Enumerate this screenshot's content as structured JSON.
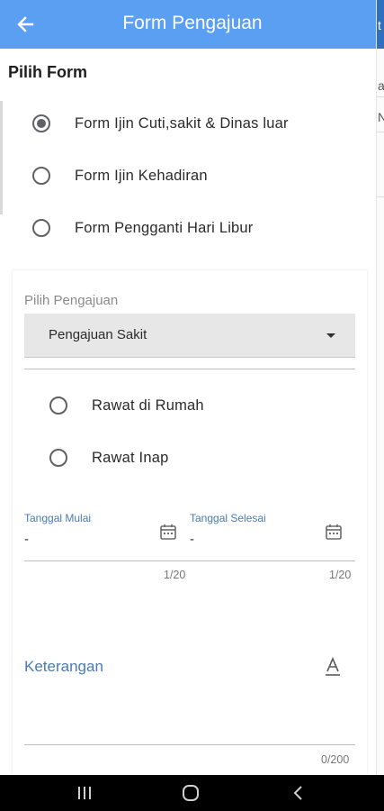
{
  "app": {
    "title": "Form Pengajuan"
  },
  "section": {
    "heading": "Pilih Form"
  },
  "form_options": [
    {
      "label": "Form Ijin Cuti,sakit & Dinas luar",
      "selected": true
    },
    {
      "label": "Form Ijin Kehadiran",
      "selected": false
    },
    {
      "label": "Form Pengganti Hari Libur",
      "selected": false
    }
  ],
  "pengajuan": {
    "label": "Pilih Pengajuan",
    "value": "Pengajuan Sakit"
  },
  "rawat_options": [
    {
      "label": "Rawat di Rumah",
      "selected": false
    },
    {
      "label": "Rawat Inap",
      "selected": false
    }
  ],
  "tanggal_mulai": {
    "label": "Tanggal Mulai",
    "value": "-",
    "counter": "1/20"
  },
  "tanggal_selesai": {
    "label": "Tanggal Selesai",
    "value": "-",
    "counter": "1/20"
  },
  "keterangan": {
    "label": "Keterangan",
    "counter": "0/200"
  },
  "icons": {
    "back": "arrow-left-icon",
    "calendar": "calendar-icon",
    "text_format": "text-format-icon",
    "nav_recents": "recents-icon",
    "nav_home": "home-icon",
    "nav_back": "chevron-left-icon"
  },
  "edge_text": [
    "t",
    "a",
    "N"
  ],
  "colors": {
    "appbar": "#5a9ff2",
    "accent": "#4a7bb0"
  }
}
